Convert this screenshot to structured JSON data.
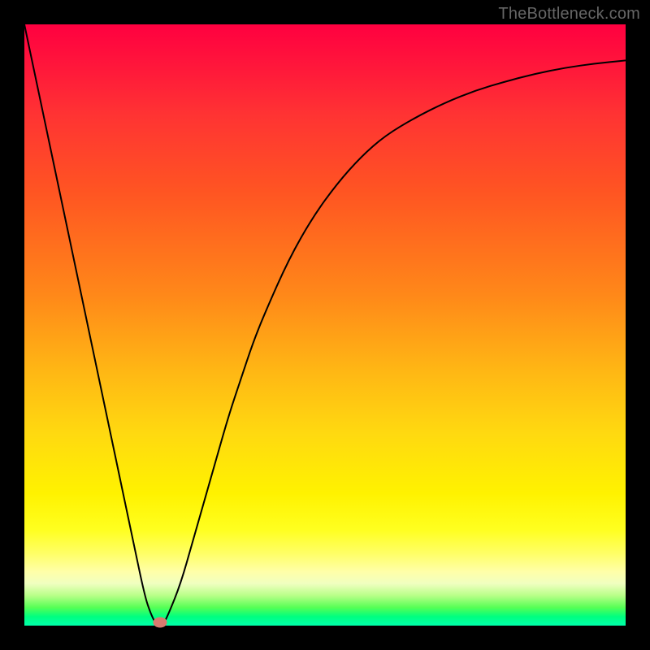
{
  "attribution": "TheBottleneck.com",
  "colors": {
    "frame": "#000000",
    "gradient_top": "#ff0040",
    "gradient_bottom": "#00ffaa",
    "curve": "#000000",
    "marker": "#d87a6f"
  },
  "chart_data": {
    "type": "line",
    "title": "",
    "xlabel": "",
    "ylabel": "",
    "xlim": [
      0,
      100
    ],
    "ylim": [
      0,
      100
    ],
    "annotations": [
      {
        "text": "TheBottleneck.com",
        "position": "top-right"
      }
    ],
    "series": [
      {
        "name": "bottleneck-curve",
        "x": [
          0,
          2,
          4,
          6,
          8,
          10,
          12,
          14,
          16,
          18,
          20,
          21,
          22,
          23,
          24,
          26,
          28,
          30,
          32,
          34,
          36,
          38,
          40,
          44,
          48,
          52,
          56,
          60,
          65,
          70,
          75,
          80,
          85,
          90,
          95,
          100
        ],
        "values": [
          100,
          90.5,
          81,
          71.5,
          62,
          52.5,
          43,
          33.5,
          24,
          14.5,
          5,
          2,
          0,
          0,
          2,
          7,
          14,
          21,
          28,
          35,
          41,
          47,
          52,
          61,
          68,
          73.5,
          78,
          81.5,
          84.5,
          87,
          89,
          90.5,
          91.8,
          92.8,
          93.5,
          94
        ]
      }
    ],
    "markers": [
      {
        "name": "optimal-point",
        "x": 22.5,
        "y": 0.6
      }
    ]
  }
}
